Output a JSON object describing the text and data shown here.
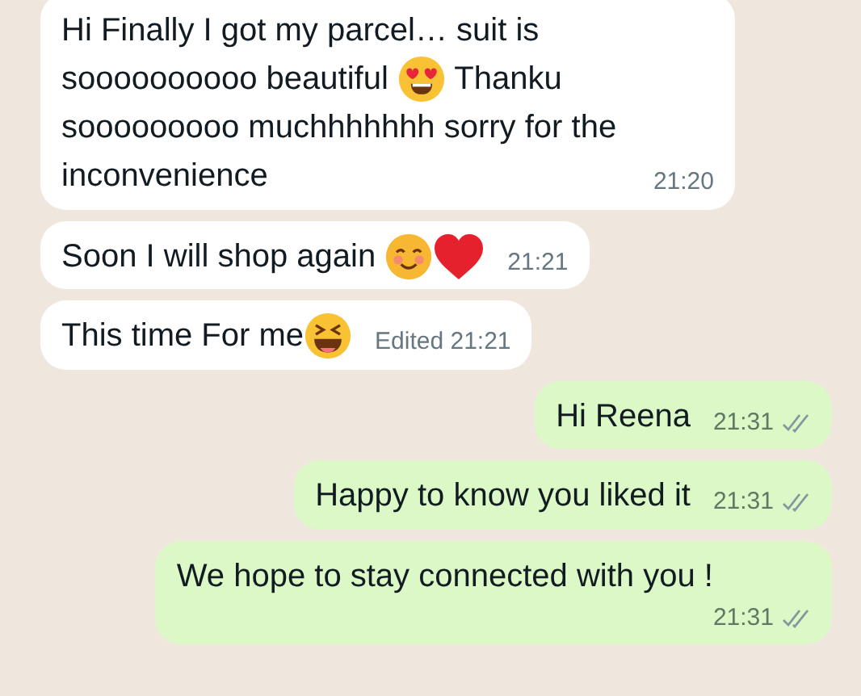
{
  "messages": [
    {
      "outgoing": false,
      "parts": [
        {
          "kind": "text",
          "text": "Hi Finally I got my parcel… suit is"
        },
        {
          "kind": "text",
          "text": "soooooooooo beautiful "
        },
        {
          "kind": "heart_eyes"
        },
        {
          "kind": "text",
          "text": " Thanku"
        },
        {
          "kind": "text",
          "text": "sooooooooo muchhhhhhh sorry for the"
        },
        {
          "kind": "text",
          "text": "inconvenience"
        }
      ],
      "time": "21:20"
    },
    {
      "outgoing": false,
      "parts": [
        {
          "kind": "text",
          "text": "Soon I will shop again "
        },
        {
          "kind": "smiling"
        },
        {
          "kind": "heart"
        }
      ],
      "time": "21:21"
    },
    {
      "outgoing": false,
      "parts": [
        {
          "kind": "text",
          "text": "This time For me"
        },
        {
          "kind": "laughing"
        }
      ],
      "time": "Edited 21:21"
    },
    {
      "outgoing": true,
      "parts": [
        {
          "kind": "text",
          "text": "Hi Reena"
        }
      ],
      "time": "21:31",
      "read": false
    },
    {
      "outgoing": true,
      "parts": [
        {
          "kind": "text",
          "text": "Happy to know you liked it"
        }
      ],
      "time": "21:31",
      "read": false
    },
    {
      "outgoing": true,
      "parts": [
        {
          "kind": "text",
          "text": "We hope to stay connected with you !"
        }
      ],
      "time": "21:31",
      "read": false,
      "time_below": true
    }
  ]
}
